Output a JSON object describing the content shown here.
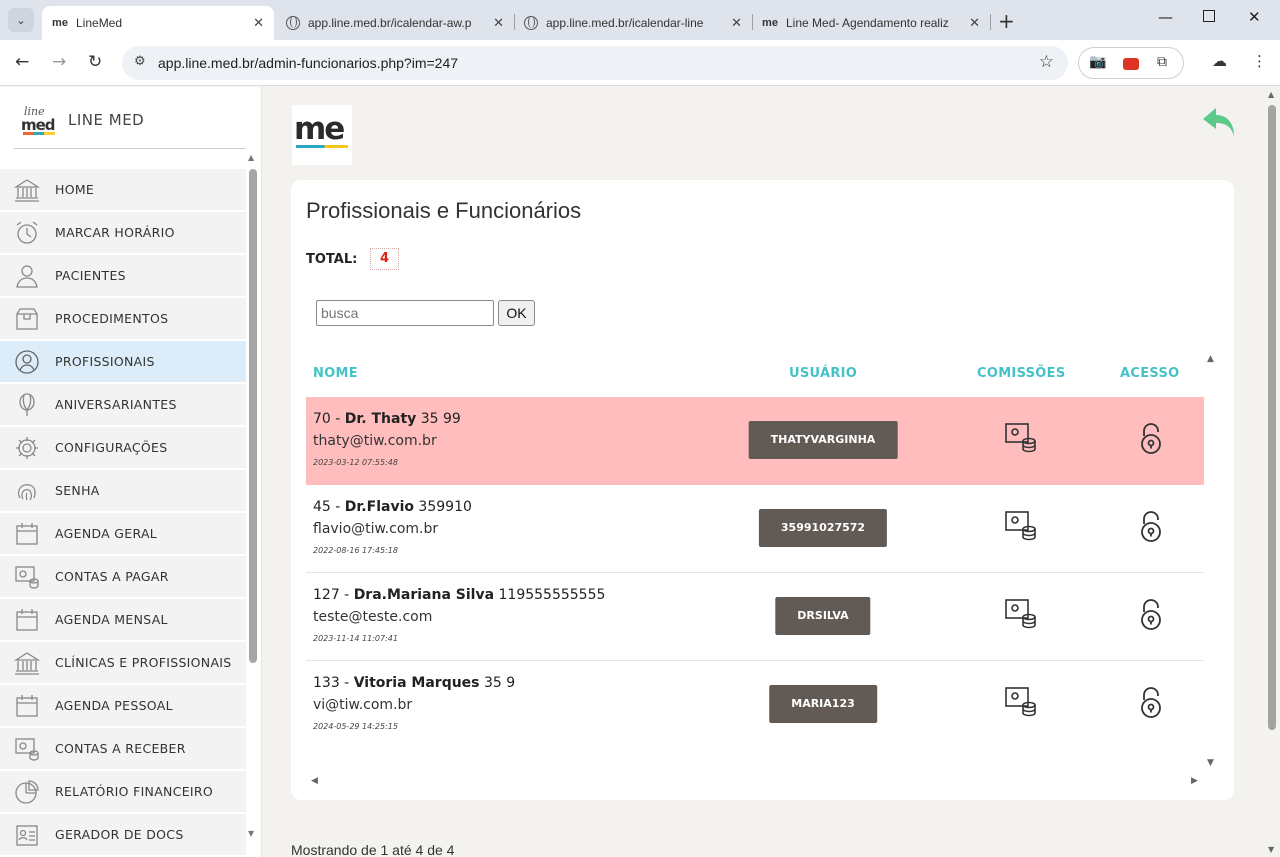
{
  "browser": {
    "tabs": [
      {
        "favicon": "me",
        "title": "LineMed",
        "active": true
      },
      {
        "favicon": "globe",
        "title": "app.line.med.br/icalendar-aw.p",
        "active": false
      },
      {
        "favicon": "globe",
        "title": "app.line.med.br/icalendar-line",
        "active": false
      },
      {
        "favicon": "me",
        "title": "Line Med- Agendamento realiz",
        "active": false
      }
    ],
    "url": "app.line.med.br/admin-funcionarios.php?im=247"
  },
  "sidebar": {
    "brand_logo_top": "line",
    "brand_logo_bottom": "med",
    "brand_name": "LINE MED",
    "items": [
      {
        "label": "HOME",
        "icon": "bank-icon"
      },
      {
        "label": "MARCAR HORÁRIO",
        "icon": "alarm-clock-icon"
      },
      {
        "label": "PACIENTES",
        "icon": "user-icon"
      },
      {
        "label": "PROCEDIMENTOS",
        "icon": "box-icon"
      },
      {
        "label": "PROFISSIONAIS",
        "icon": "user-circle-icon"
      },
      {
        "label": "ANIVERSARIANTES",
        "icon": "balloon-icon"
      },
      {
        "label": "CONFIGURAÇÕES",
        "icon": "gear-icon"
      },
      {
        "label": "SENHA",
        "icon": "fingerprint-icon"
      },
      {
        "label": "AGENDA GERAL",
        "icon": "calendar-icon"
      },
      {
        "label": "CONTAS A PAGAR",
        "icon": "money-icon"
      },
      {
        "label": "AGENDA MENSAL",
        "icon": "calendar-icon"
      },
      {
        "label": "CLÍNICAS E PROFISSIONAIS",
        "icon": "bank-icon"
      },
      {
        "label": "AGENDA PESSOAL",
        "icon": "calendar-icon"
      },
      {
        "label": "CONTAS A RECEBER",
        "icon": "money-icon"
      },
      {
        "label": "RELATÓRIO FINANCEIRO",
        "icon": "pie-chart-icon"
      },
      {
        "label": "GERADOR DE DOCS",
        "icon": "id-card-icon"
      }
    ]
  },
  "main": {
    "logo_text": "me",
    "title": "Profissionais e Funcionários",
    "total_label": "TOTAL:",
    "total_value": "4",
    "search": {
      "placeholder": "busca",
      "button": "OK"
    },
    "columns": {
      "nome": "NOME",
      "usuario": "USUÁRIO",
      "comissoes": "COMISSÕES",
      "acesso": "ACESSO"
    },
    "rows": [
      {
        "id": "70",
        "sep": " - ",
        "name": "Dr. Thaty",
        "phone": " 35 99",
        "email": "thaty@tiw.com.br",
        "date": "2023-03-12 07:55:48",
        "user": "THATYVARGINHA",
        "highlight": true
      },
      {
        "id": "45",
        "sep": " - ",
        "name": "Dr.Flavio",
        "phone": " 359910",
        "email": "flavio@tiw.com.br",
        "date": "2022-08-16 17:45:18",
        "user": "35991027572",
        "highlight": false
      },
      {
        "id": "127",
        "sep": " - ",
        "name": "Dra.Mariana Silva",
        "phone": " 119555555555",
        "email": "teste@teste.com",
        "date": "2023-11-14 11:07:41",
        "user": "DRSILVA",
        "highlight": false
      },
      {
        "id": "133",
        "sep": " - ",
        "name": "Vitoria Marques",
        "phone": " 35 9",
        "email": "vi@tiw.com.br",
        "date": "2024-05-29 14:25:15",
        "user": "MARIA123",
        "highlight": false
      }
    ],
    "footer": "Mostrando de 1 até 4 de 4"
  },
  "colors": {
    "accent": "#46c1c8",
    "highlight_row": "#ffbdbe",
    "user_button": "#625a55",
    "active_menu": "#dcedf9",
    "back_arrow": "#5bc98a"
  }
}
